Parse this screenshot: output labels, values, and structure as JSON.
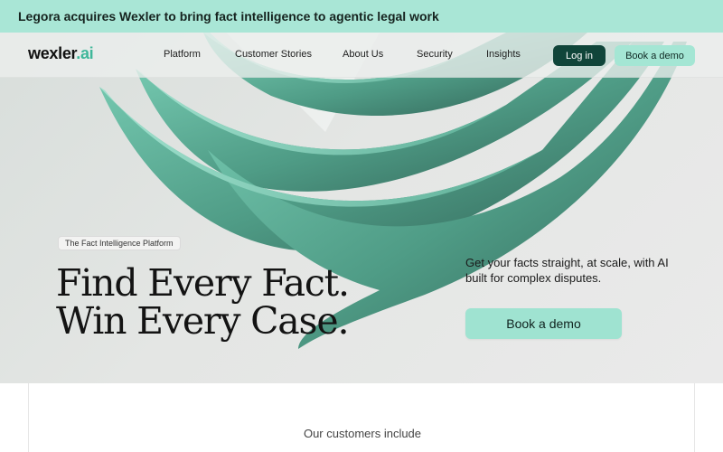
{
  "announcement": {
    "text": "Legora acquires Wexler to bring fact intelligence to agentic legal work"
  },
  "nav": {
    "logo_main": "wexler",
    "logo_suffix": ".ai",
    "links": [
      "Platform",
      "Customer Stories",
      "About Us",
      "Security",
      "Insights"
    ],
    "login_label": "Log in",
    "demo_label": "Book a demo"
  },
  "hero": {
    "tag": "The Fact Intelligence Platform",
    "headline_line1": "Find Every Fact.",
    "headline_line2": "Win Every Case.",
    "subtext": "Get your facts straight, at scale, with AI built for complex disputes.",
    "cta_label": "Book a demo"
  },
  "customers": {
    "title": "Our customers include"
  },
  "colors": {
    "accent_mint": "#a9e6d6",
    "brand_dark_green": "#10453a",
    "ribbon_teal": "#5fb59c"
  }
}
